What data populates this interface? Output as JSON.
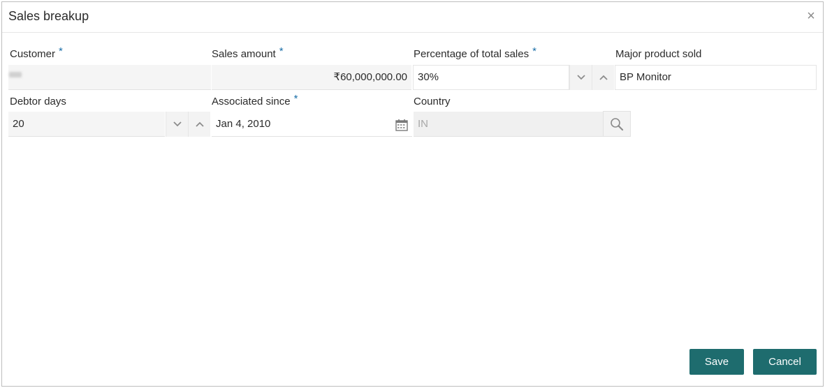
{
  "dialog": {
    "title": "Sales breakup",
    "close_icon": "close-icon"
  },
  "fields": {
    "customer": {
      "label": "Customer",
      "required_mark": "*"
    },
    "sales_amount": {
      "label": "Sales amount",
      "required_mark": "*",
      "value": "₹60,000,000.00"
    },
    "percentage": {
      "label": "Percentage of total sales",
      "required_mark": "*",
      "value": "30%"
    },
    "major_product": {
      "label": "Major product sold",
      "value": "BP Monitor"
    },
    "debtor_days": {
      "label": "Debtor days",
      "value": "20"
    },
    "associated_since": {
      "label": "Associated since",
      "required_mark": "*",
      "value": "Jan 4, 2010",
      "icon": "calendar-icon"
    },
    "country": {
      "label": "Country",
      "value": "IN",
      "icon": "search-icon"
    }
  },
  "buttons": {
    "save": "Save",
    "cancel": "Cancel"
  },
  "colors": {
    "accent": "#1e6c6e",
    "required": "#1b6fa8"
  }
}
